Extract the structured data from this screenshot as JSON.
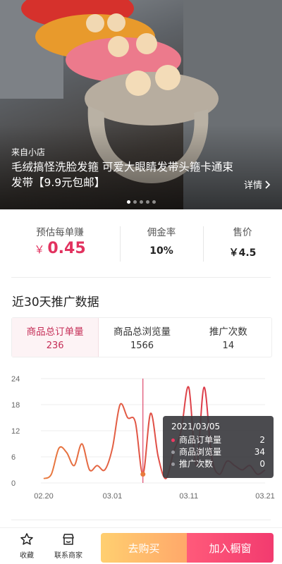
{
  "product": {
    "source_label": "来自小店",
    "title": "毛绒搞怪洗脸发箍 可爱大眼睛发带头箍卡通束发带【9.9元包邮】",
    "detail_label": "详情",
    "carousel": {
      "count": 5,
      "active_index": 0
    }
  },
  "stats": {
    "earn_label": "预估每单赚",
    "earn_currency": "￥",
    "earn_value": "0.45",
    "rate_label": "佣金率",
    "rate_value": "10%",
    "price_label": "售价",
    "price_value": "￥4.5"
  },
  "section_title": "近30天推广数据",
  "tabs": [
    {
      "label": "商品总订单量",
      "value": "236"
    },
    {
      "label": "商品总浏览量",
      "value": "1566"
    },
    {
      "label": "推广次数",
      "value": "14"
    }
  ],
  "colors": {
    "accent": "#e2325f",
    "line_orange": "#e87a3e",
    "line_red": "#d8254f",
    "cursor": "#d8254f"
  },
  "chart_data": {
    "type": "line",
    "x_tick_labels": [
      "02.20",
      "03.01",
      "03.11",
      "03.21"
    ],
    "y_tick_labels": [
      "0",
      "6",
      "12",
      "18",
      "24"
    ],
    "ylim": [
      0,
      24
    ],
    "series": [
      {
        "name": "商品订单量",
        "x": [
          "02.20",
          "02.21",
          "02.22",
          "02.23",
          "02.24",
          "02.25",
          "02.26",
          "02.27",
          "02.28",
          "03.01",
          "03.02",
          "03.03",
          "03.04",
          "03.05",
          "03.06",
          "03.07",
          "03.08",
          "03.09",
          "03.10",
          "03.11",
          "03.12",
          "03.13",
          "03.14",
          "03.15",
          "03.16",
          "03.17",
          "03.18",
          "03.19",
          "03.20",
          "03.21"
        ],
        "values": [
          1,
          2,
          8,
          7,
          4,
          9,
          3,
          4,
          3,
          8,
          18,
          15,
          14,
          2,
          16,
          6,
          1,
          7,
          12,
          22,
          4,
          22,
          6,
          2,
          5,
          4,
          3,
          4,
          2,
          3
        ]
      }
    ],
    "tooltip": {
      "date": "2021/03/05",
      "rows": [
        {
          "label": "商品订单量",
          "value": "2"
        },
        {
          "label": "商品浏览量",
          "value": "34"
        },
        {
          "label": "推广次数",
          "value": "0"
        }
      ]
    }
  },
  "bottom": {
    "favorite_label": "收藏",
    "contact_label": "联系商家",
    "buy_label": "去购买",
    "add_label": "加入橱窗"
  }
}
